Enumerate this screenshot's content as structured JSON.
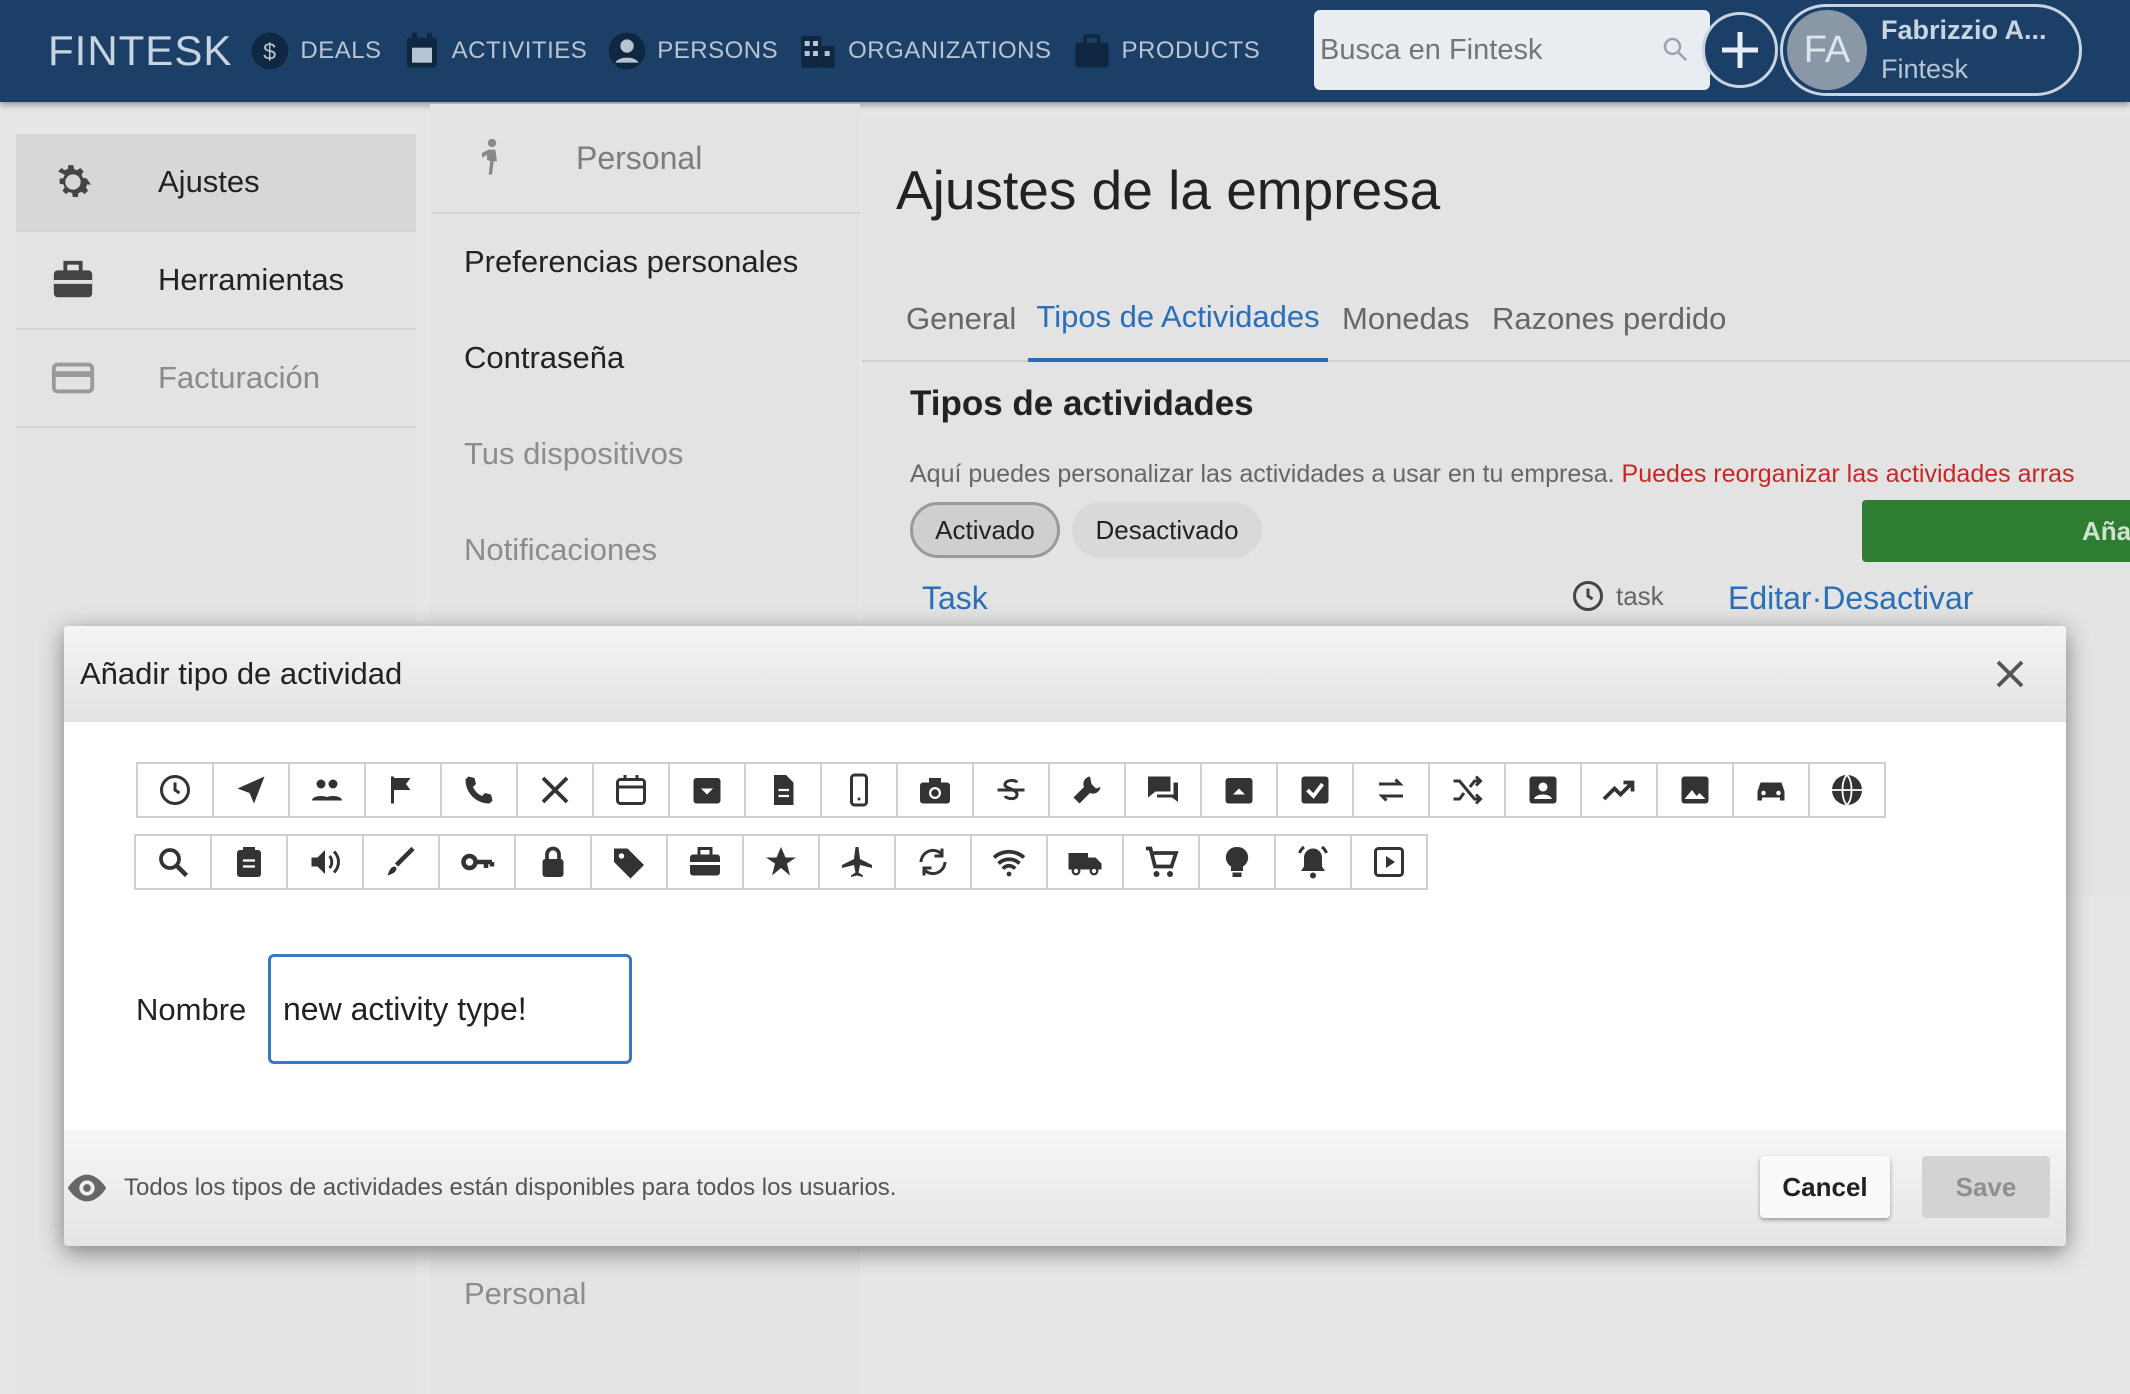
{
  "topbar": {
    "brand": "FINTESK",
    "nav": [
      {
        "label": "DEALS",
        "icon": "dollar-circle-icon"
      },
      {
        "label": "ACTIVITIES",
        "icon": "calendar-icon"
      },
      {
        "label": "PERSONS",
        "icon": "person-circle-icon"
      },
      {
        "label": "ORGANIZATIONS",
        "icon": "building-icon"
      },
      {
        "label": "PRODUCTS",
        "icon": "briefcase-icon"
      }
    ],
    "search_placeholder": "Busca en Fintesk",
    "user": {
      "initials": "FA",
      "name": "Fabrizzio A...",
      "org": "Fintesk"
    }
  },
  "sidebar": {
    "items": [
      {
        "label": "Ajustes",
        "icon": "gear-icon"
      },
      {
        "label": "Herramientas",
        "icon": "toolbox-icon"
      },
      {
        "label": "Facturación",
        "icon": "credit-card-icon"
      }
    ]
  },
  "settings_menu": {
    "header": "Personal",
    "items": [
      "Preferencias personales",
      "Contraseña",
      "Tus dispositivos",
      "Notificaciones"
    ],
    "bottom": "Personal"
  },
  "main": {
    "title": "Ajustes de la empresa",
    "tabs": [
      "General",
      "Tipos de Actividades",
      "Monedas",
      "Razones perdido"
    ],
    "active_tab": "Tipos de Actividades",
    "section_title": "Tipos de actividades",
    "description": "Aquí puedes personalizar las actividades a usar en tu empresa.",
    "description_warning": "Puedes reorganizar las actividades arras",
    "filter_on": "Activado",
    "filter_off": "Desactivado",
    "add_button": "Añadir tipo de activ",
    "rows": [
      {
        "name": "Task",
        "key": "task",
        "edit": "Editar",
        "sep": "·",
        "deactivate": "Desactivar"
      }
    ]
  },
  "modal": {
    "title": "Añadir tipo de actividad",
    "icons_row1": [
      "clock",
      "send",
      "people",
      "flag",
      "phone",
      "utensils",
      "calendar",
      "archive-down",
      "document",
      "mobile",
      "camera",
      "strikethrough",
      "wrench",
      "chat",
      "archive-up",
      "checkbox",
      "swap",
      "shuffle",
      "contact-card",
      "trending-up",
      "image",
      "car",
      "globe"
    ],
    "icons_row2": [
      "search",
      "clipboard",
      "volume",
      "brush",
      "key",
      "lock",
      "tag",
      "briefcase",
      "star",
      "airplane",
      "refresh",
      "wifi",
      "truck",
      "cart",
      "lightbulb",
      "alarm",
      "play-square"
    ],
    "name_label": "Nombre",
    "name_value": "new activity type!",
    "footer_text": "Todos los tipos de actividades están disponibles para todos los usuarios.",
    "cancel": "Cancel",
    "save": "Save"
  }
}
